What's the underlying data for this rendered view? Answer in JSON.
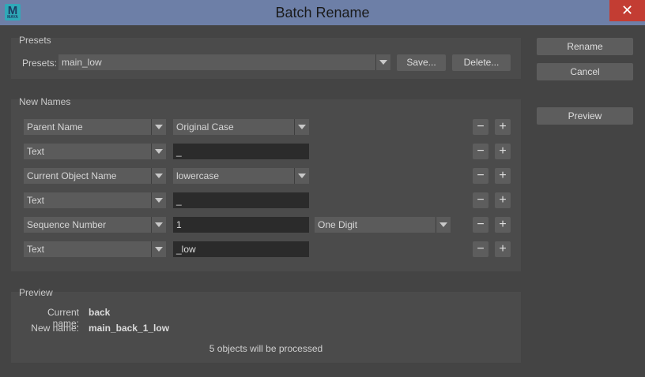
{
  "window": {
    "title": "Batch Rename",
    "app_icon_letter": "M",
    "app_icon_sub": "MAYA",
    "close": "✕"
  },
  "presets": {
    "section_title": "Presets",
    "field_label": "Presets:",
    "selected": "main_low",
    "save_label": "Save...",
    "delete_label": "Delete..."
  },
  "new_names": {
    "section_title": "New Names",
    "rows": [
      {
        "type": "Parent Name",
        "value": "Original Case"
      },
      {
        "type": "Text",
        "value": "_"
      },
      {
        "type": "Current Object Name",
        "value": "lowercase"
      },
      {
        "type": "Text",
        "value": "_"
      },
      {
        "type": "Sequence Number",
        "value": "1",
        "extra": "One Digit"
      },
      {
        "type": "Text",
        "value": "_low"
      }
    ],
    "remove_symbol": "−",
    "add_symbol": "+"
  },
  "preview": {
    "section_title": "Preview",
    "current_label": "Current name:",
    "current_value": "back",
    "new_label": "New name:",
    "new_value": "main_back_1_low",
    "status": "5 objects will be processed"
  },
  "actions": {
    "rename": "Rename",
    "cancel": "Cancel",
    "preview": "Preview"
  }
}
